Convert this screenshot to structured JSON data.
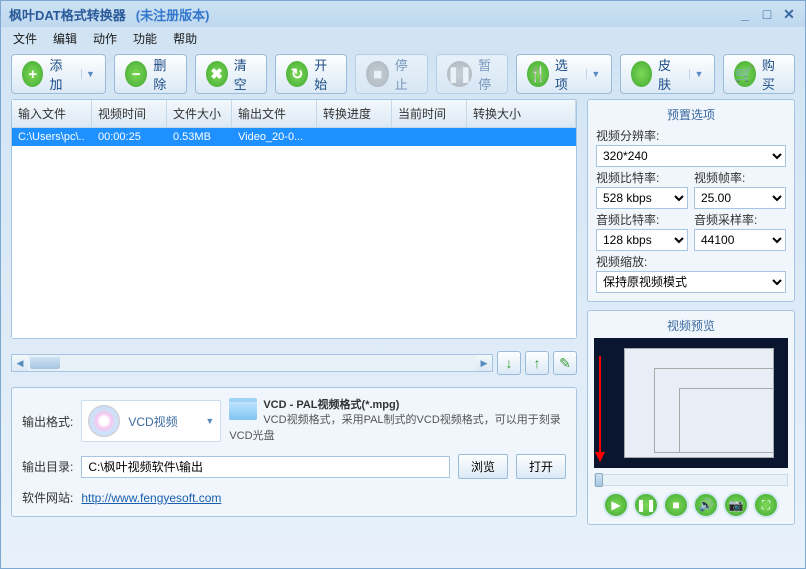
{
  "title": "枫叶DAT格式转换器",
  "version": "(未注册版本)",
  "menu": {
    "file": "文件",
    "edit": "编辑",
    "action": "动作",
    "function": "功能",
    "help": "帮助"
  },
  "toolbar": {
    "add": "添加",
    "delete": "删除",
    "clear": "清空",
    "start": "开始",
    "stop": "停止",
    "pause": "暂停",
    "options": "选项",
    "skin": "皮肤",
    "buy": "购买"
  },
  "table": {
    "headers": {
      "input": "输入文件",
      "duration": "视频时间",
      "size": "文件大小",
      "output": "输出文件",
      "progress": "转换进度",
      "curtime": "当前时间",
      "convsize": "转换大小"
    },
    "rows": [
      {
        "input": "C:\\Users\\pc\\..",
        "duration": "00:00:25",
        "size": "0.53MB",
        "output": "Video_20-0...",
        "progress": "",
        "curtime": "",
        "convsize": ""
      }
    ]
  },
  "output": {
    "format_label": "输出格式:",
    "format_name": "VCD视频",
    "desc_title": "VCD - PAL视频格式(*.mpg)",
    "desc_text": "VCD视频格式，采用PAL制式的VCD视频格式，可以用于刻录VCD光盘",
    "dir_label": "输出目录:",
    "dir_value": "C:\\枫叶视频软件\\输出",
    "browse": "浏览",
    "open": "打开",
    "site_label": "软件网站:",
    "site_url": "http://www.fengyesoft.com"
  },
  "preset": {
    "title": "预置选项",
    "res_label": "视频分辨率:",
    "res_value": "320*240",
    "vbitrate_label": "视频比特率:",
    "vbitrate_value": "528 kbps",
    "vfps_label": "视频帧率:",
    "vfps_value": "25.00",
    "abitrate_label": "音频比特率:",
    "abitrate_value": "128 kbps",
    "asample_label": "音频采样率:",
    "asample_value": "44100",
    "scale_label": "视频缩放:",
    "scale_value": "保持原视频模式"
  },
  "preview": {
    "title": "视频预览"
  }
}
